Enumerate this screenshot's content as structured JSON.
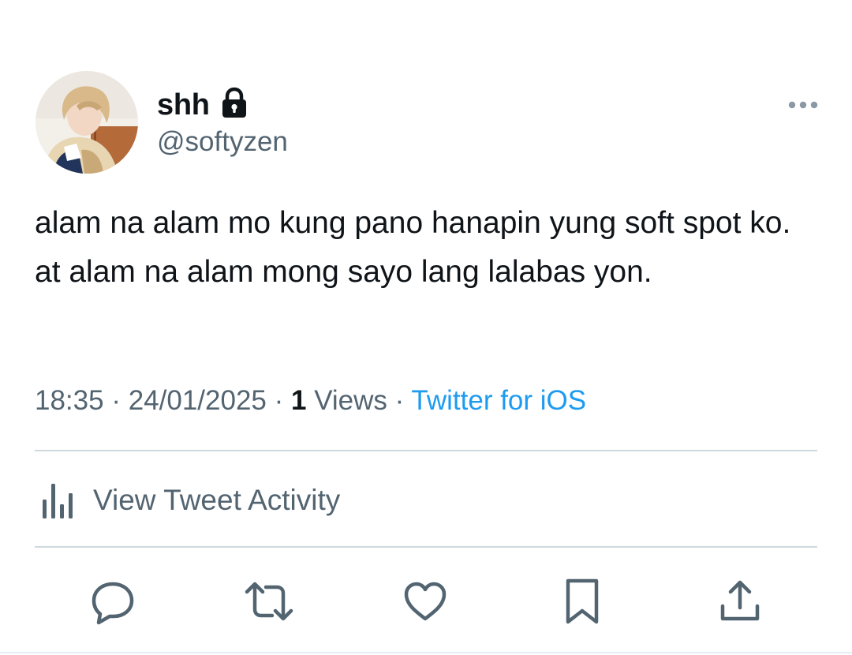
{
  "author": {
    "display_name": "shh",
    "handle": "@softyzen",
    "protected_icon": "lock-icon",
    "avatar": "avatar-photo"
  },
  "tweet": {
    "text": "alam na alam mo kung pano hanapin yung soft spot ko. at alam na alam mong sayo lang lalabas yon."
  },
  "meta": {
    "time": "18:35",
    "separator": " · ",
    "date": "24/01/2025",
    "views_count": "1",
    "views_label": "Views",
    "source": "Twitter for iOS"
  },
  "activity": {
    "label": "View Tweet Activity",
    "icon": "bar-chart-icon"
  },
  "actions": [
    {
      "name": "reply",
      "icon": "reply-icon"
    },
    {
      "name": "retweet",
      "icon": "retweet-icon"
    },
    {
      "name": "like",
      "icon": "heart-icon"
    },
    {
      "name": "bookmark",
      "icon": "bookmark-icon"
    },
    {
      "name": "share",
      "icon": "share-icon"
    }
  ],
  "colors": {
    "text_primary": "#0f1419",
    "text_secondary": "#536471",
    "accent": "#1d9bf0",
    "divider": "#cfd9de"
  }
}
